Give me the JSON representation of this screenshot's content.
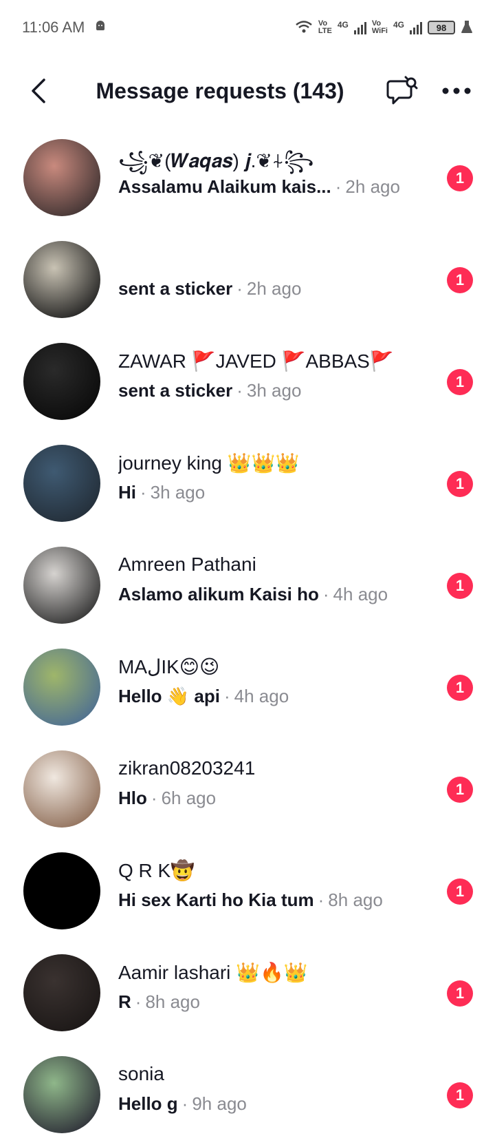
{
  "status_bar": {
    "time": "11:06 AM",
    "volte_top": "Vo",
    "volte_bottom": "LTE",
    "net1": "4G",
    "vowifi_top": "Vo",
    "vowifi_bottom": "WiFi",
    "net2": "4G",
    "battery": "98"
  },
  "header": {
    "title": "Message requests (143)"
  },
  "colors": {
    "badge": "#fe2c55",
    "secondary_text": "#8a8b91",
    "primary_text": "#161823"
  },
  "requests": [
    {
      "name": "꧁❦(𝑾𝒂𝒒𝒂𝒔) 𝒋.❦⍭꧂",
      "preview": "Assalamu Alaikum kais...",
      "time": "2h ago",
      "badge": "1",
      "avatar_colors": [
        "#c98a7e",
        "#3a2f2f"
      ]
    },
    {
      "name": "",
      "preview": "sent a sticker",
      "time": "2h ago",
      "badge": "1",
      "avatar_colors": [
        "#c9c3b4",
        "#1a1a1a"
      ]
    },
    {
      "name": "ZAWAR 🚩JAVED 🚩ABBAS🚩",
      "preview": "sent a sticker",
      "time": "3h ago",
      "badge": "1",
      "avatar_colors": [
        "#2a2a2a",
        "#0a0a0a"
      ]
    },
    {
      "name": "journey king 👑👑👑",
      "preview": "Hi",
      "time": "3h ago",
      "badge": "1",
      "avatar_colors": [
        "#3f5a72",
        "#222c36"
      ]
    },
    {
      "name": "Amreen Pathani",
      "preview": "Aslamo alikum Kaisi ho",
      "time": "4h ago",
      "badge": "1",
      "avatar_colors": [
        "#d6d3d0",
        "#2b2b2b"
      ]
    },
    {
      "name": "MAلIK😊😉",
      "preview": "Hello 👋 api",
      "time": "4h ago",
      "badge": "1",
      "avatar_colors": [
        "#9fb66a",
        "#4a6c93"
      ]
    },
    {
      "name": "zikran08203241",
      "preview": "Hlo",
      "time": "6h ago",
      "badge": "1",
      "avatar_colors": [
        "#f0e8e0",
        "#8c6a54"
      ]
    },
    {
      "name": "Q R K🤠",
      "preview": "Hi sex Karti ho Kia tum",
      "time": "8h ago",
      "badge": "1",
      "avatar_colors": [
        "#000000",
        "#000000"
      ]
    },
    {
      "name": "Aamir lashari 👑🔥👑",
      "preview": "R",
      "time": "8h ago",
      "badge": "1",
      "avatar_colors": [
        "#3a3230",
        "#1b1716"
      ]
    },
    {
      "name": "sonia",
      "preview": "Hello g",
      "time": "9h ago",
      "badge": "1",
      "avatar_colors": [
        "#8fb78a",
        "#2a2a35"
      ]
    }
  ]
}
